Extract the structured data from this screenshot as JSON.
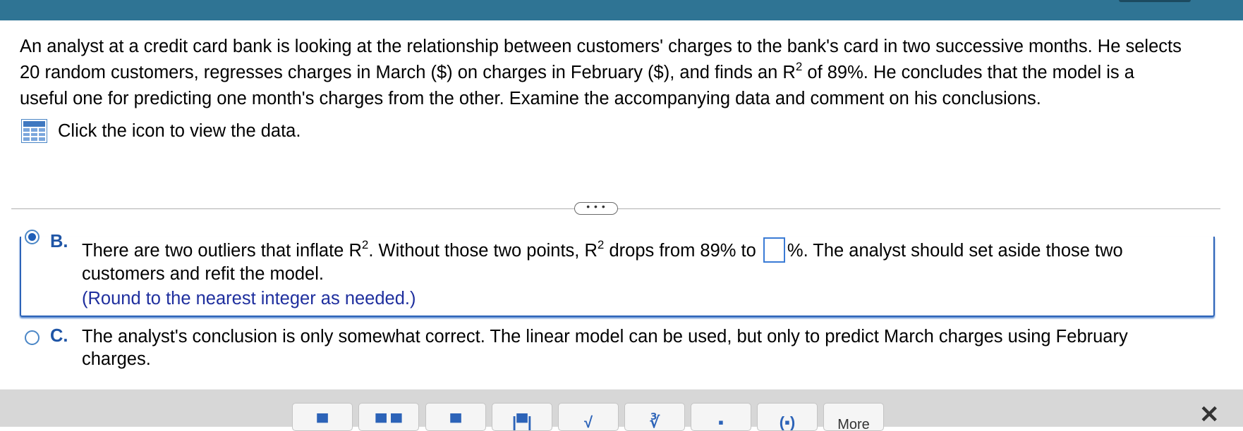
{
  "question": {
    "line1": "An analyst at a credit card bank is looking at the relationship between customers' charges to the bank's card in two successive months. He selects",
    "line2_a": "20 random customers, regresses charges in March ($) on charges in February ($), and finds an R",
    "line2_sup": "2",
    "line2_b": " of 89%. He concludes that the model is a",
    "line3": "useful one for predicting one month's charges from the other. Examine the accompanying data and comment on his conclusions.",
    "data_link": "Click the icon to view the data."
  },
  "icons": {
    "data_table": "grid-table-icon",
    "expand": "ellipsis-icon",
    "close": "close-icon"
  },
  "ellipsis_label": "• • •",
  "option_b": {
    "letter": "B.",
    "text_a": "There are two outliers that inflate R",
    "sup1": "2",
    "text_b": ". Without those two points, R",
    "sup2": "2",
    "text_c": " drops from 89% to ",
    "text_d": "%. The analyst should set aside those two",
    "text_line2": "customers and refit the model.",
    "hint": "(Round to the nearest integer as needed.)",
    "answer_value": "",
    "selected": true
  },
  "option_c": {
    "letter": "C.",
    "line1": "The analyst's conclusion is only somewhat correct. The linear model can be used, but only to predict March charges using February",
    "line2": "charges."
  },
  "toolbar": {
    "buttons": [
      {
        "name": "tool-fraction",
        "glyph": "▀"
      },
      {
        "name": "tool-mixed-number",
        "glyph": "▀ ▀"
      },
      {
        "name": "tool-exponent",
        "glyph": "▀"
      },
      {
        "name": "tool-absolute-value",
        "glyph": "|▀|"
      },
      {
        "name": "tool-square-root",
        "glyph": "√"
      },
      {
        "name": "tool-nth-root",
        "glyph": "∛"
      },
      {
        "name": "tool-decimal",
        "glyph": "▪"
      },
      {
        "name": "tool-parentheses",
        "glyph": "(▪)"
      }
    ],
    "more_label": "More"
  },
  "colors": {
    "header": "#2f7494",
    "accent": "#2c63b8",
    "hint_text": "#1f2f9e",
    "toolbar_bg": "#d7d7d7"
  }
}
